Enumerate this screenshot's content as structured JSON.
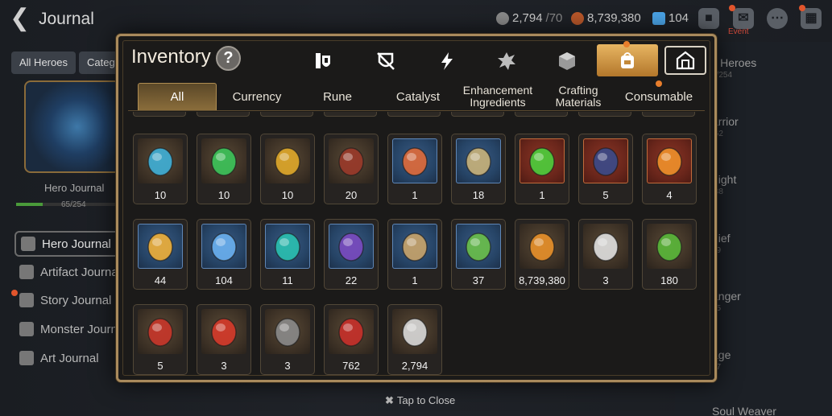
{
  "journal": {
    "title": "Journal",
    "resources": [
      {
        "value": "2,794",
        "sub": "/70",
        "icon": "stamina-icon",
        "color": "#b9b9b9"
      },
      {
        "value": "8,739,380",
        "sub": "",
        "icon": "gold-icon",
        "color": "#b8572a"
      },
      {
        "value": "104",
        "sub": "",
        "icon": "crystal-icon",
        "color": "#4aa3e6"
      }
    ],
    "event_label": "Event",
    "filters": [
      "All Heroes",
      "Categ"
    ],
    "hero": {
      "label": "Hero Journal",
      "count": "65/254",
      "progress": 0.256
    },
    "side_items": [
      "Hero Journal",
      "Artifact Journal",
      "Story Journal",
      "Monster Journal",
      "Art Journal"
    ],
    "right_list": [
      {
        "label": "ll Heroes",
        "sub": "5/254"
      },
      {
        "label": "arrior",
        "sub": "/62"
      },
      {
        "label": "night",
        "sub": "/38"
      },
      {
        "label": "hief",
        "sub": "39"
      },
      {
        "label": "anger",
        "sub": "35"
      },
      {
        "label": "age",
        "sub": "47"
      },
      {
        "label": "Soul Weaver",
        "sub": ""
      }
    ],
    "tap_to_close": "Tap to Close"
  },
  "inventory": {
    "title": "Inventory",
    "help": "?",
    "category_tabs": [
      {
        "icon": "equipment-icon"
      },
      {
        "icon": "no-sword-icon"
      },
      {
        "icon": "lightning-icon"
      },
      {
        "icon": "spiky-creature-icon"
      },
      {
        "icon": "cube-icon"
      },
      {
        "icon": "backpack-icon",
        "active": true
      },
      {
        "icon": "storage-house-icon"
      }
    ],
    "sub_tabs": [
      {
        "label": "All",
        "active": true
      },
      {
        "label": "Currency"
      },
      {
        "label": "Rune"
      },
      {
        "label": "Catalyst"
      },
      {
        "label": "Enhancement Ingredients"
      },
      {
        "label": "Crafting Materials"
      },
      {
        "label": "Consumable"
      }
    ],
    "items": [
      {
        "icon": "blue-rune-icon",
        "count": "10",
        "frame": "default",
        "color": "#3fb0d8"
      },
      {
        "icon": "green-rune-icon",
        "count": "10",
        "frame": "default",
        "color": "#3cc45a"
      },
      {
        "icon": "gold-rune-icon",
        "count": "10",
        "frame": "default",
        "color": "#e0a82a"
      },
      {
        "icon": "dark-claw-icon",
        "count": "20",
        "frame": "default",
        "color": "#9a3a2a"
      },
      {
        "icon": "elemental-orbs-icon",
        "count": "1",
        "frame": "blue",
        "color": "#e06a3a"
      },
      {
        "icon": "feather-charm-icon",
        "count": "18",
        "frame": "blue",
        "color": "#c9b27a"
      },
      {
        "icon": "green-potion-icon",
        "count": "1",
        "frame": "red",
        "color": "#4ccf3c"
      },
      {
        "icon": "spiral-pendant-icon",
        "count": "5",
        "frame": "red",
        "color": "#3a4a8a"
      },
      {
        "icon": "flame-crystal-icon",
        "count": "4",
        "frame": "red",
        "color": "#f0902a"
      },
      {
        "icon": "star-pendant-icon",
        "count": "44",
        "frame": "blue",
        "color": "#f0b03a"
      },
      {
        "icon": "blue-crystal-icon",
        "count": "104",
        "frame": "blue",
        "color": "#6ab0f0"
      },
      {
        "icon": "teal-crystal-icon",
        "count": "11",
        "frame": "blue",
        "color": "#2ac0b0"
      },
      {
        "icon": "purple-orb-icon",
        "count": "22",
        "frame": "blue",
        "color": "#7a4ac0"
      },
      {
        "icon": "compass-pendant-icon",
        "count": "1",
        "frame": "blue",
        "color": "#c9a46a"
      },
      {
        "icon": "green-leaf-icon",
        "count": "37",
        "frame": "blue",
        "color": "#6ac04a"
      },
      {
        "icon": "gold-coin-icon",
        "count": "8,739,380",
        "frame": "default",
        "color": "#e8902a"
      },
      {
        "icon": "gear-ball-icon",
        "count": "3",
        "frame": "default",
        "color": "#e0e0e0"
      },
      {
        "icon": "green-heart-icon",
        "count": "180",
        "frame": "default",
        "color": "#5ab83a"
      },
      {
        "icon": "red-banner-icon",
        "count": "5",
        "frame": "default",
        "color": "#c8362a"
      },
      {
        "icon": "red-seal-icon",
        "count": "3",
        "frame": "default",
        "color": "#d63a2a"
      },
      {
        "icon": "stone-gem-icon",
        "count": "3",
        "frame": "default",
        "color": "#8a8a8a"
      },
      {
        "icon": "red-mask-icon",
        "count": "762",
        "frame": "default",
        "color": "#c8302a"
      },
      {
        "icon": "silver-chess-icon",
        "count": "2,794",
        "frame": "default",
        "color": "#d8d8d8"
      }
    ]
  }
}
